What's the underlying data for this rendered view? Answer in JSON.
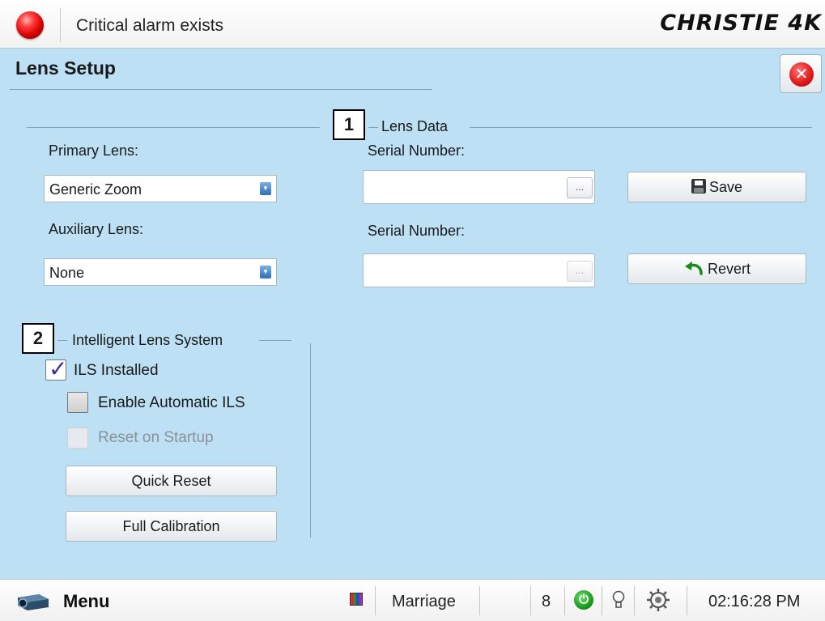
{
  "topbar": {
    "alarm_text": "Critical alarm exists",
    "brand": "CHRISTIE 4K",
    "alarm_color": "#e00000"
  },
  "page": {
    "title": "Lens Setup",
    "close_icon": "close-icon"
  },
  "lens_data": {
    "callout": "1",
    "group_label": "Lens Data",
    "primary_label": "Primary Lens:",
    "primary_value": "Generic Zoom",
    "auxiliary_label": "Auxiliary Lens:",
    "auxiliary_value": "None",
    "serial_label_1": "Serial Number:",
    "serial_value_1": "",
    "serial_label_2": "Serial Number:",
    "serial_value_2": "",
    "ellipsis": "...",
    "save_label": "Save",
    "revert_label": "Revert"
  },
  "ils": {
    "callout": "2",
    "group_label": "Intelligent Lens System",
    "installed_label": "ILS Installed",
    "installed_checked": true,
    "auto_label": "Enable Automatic ILS",
    "auto_checked": false,
    "reset_label": "Reset on Startup",
    "reset_enabled": false,
    "quick_reset_label": "Quick Reset",
    "full_calibration_label": "Full Calibration"
  },
  "taskbar": {
    "menu_label": "Menu",
    "profile_label": "Marriage",
    "channel": "8",
    "time": "02:16:28 PM",
    "icons": [
      "projector-icon",
      "palette-icon",
      "power-icon",
      "lamp-bulb-icon",
      "cooling-gear-icon"
    ]
  },
  "colors": {
    "panel_bg": "#bde0f5",
    "accent_blue": "#2f6fb5",
    "power_green": "#1d9a1d"
  }
}
